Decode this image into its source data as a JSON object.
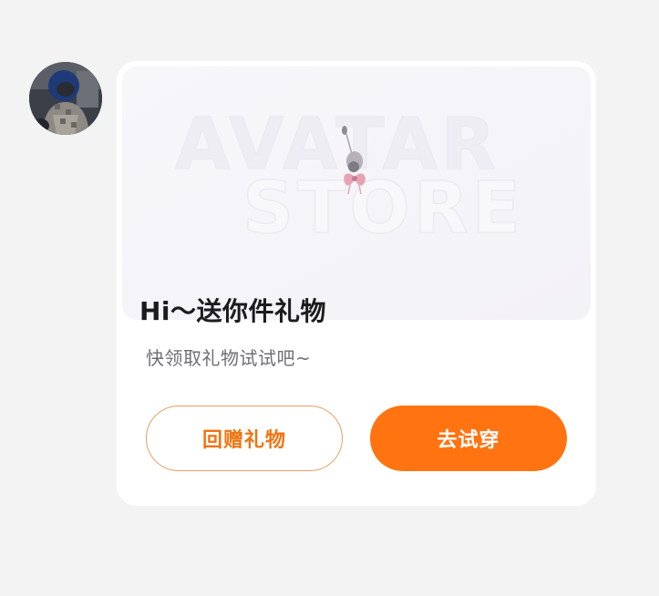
{
  "user": {
    "avatar_label": "user-avatar"
  },
  "card": {
    "banner": {
      "watermark_line1": "AVATAR",
      "watermark_line2": "STORE"
    },
    "title": "Hi～送你件礼物",
    "subtitle": "快领取礼物试试吧~",
    "buttons": {
      "gift_back": "回赠礼物",
      "try_on": "去试穿"
    }
  },
  "colors": {
    "background": "#f3f3f4",
    "card": "#ffffff",
    "accent": "#ff7310",
    "accent_text": "#f07410",
    "accent_border": "#e8a065",
    "title": "#1c1c1e",
    "subtitle": "#6f6f73"
  }
}
